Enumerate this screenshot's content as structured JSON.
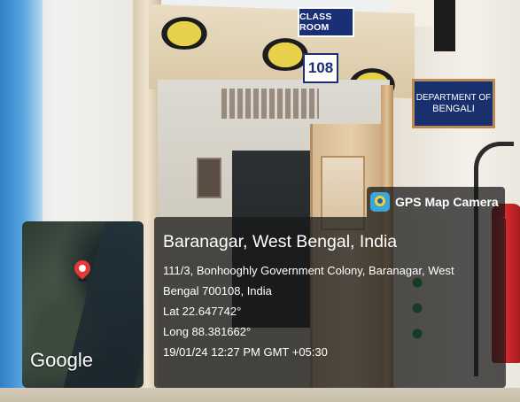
{
  "photo": {
    "signs": {
      "class_room": "CLASS ROOM",
      "room_number": "108",
      "department_line1": "DEPARTMENT OF",
      "department_line2": "BENGALI"
    }
  },
  "gps_overlay": {
    "app_name": "GPS Map Camera",
    "app_icon": "gps-camera-icon",
    "map_logo": "Google",
    "pin_icon": "map-pin-icon",
    "pin_color": "#e53935",
    "place_title": "Baranagar, West Bengal, India",
    "address_line1": "111/3, Bonhooghly Government Colony, Baranagar, West",
    "address_line2": "Bengal 700108, India",
    "latitude": "Lat 22.647742°",
    "longitude": "Long 88.381662°",
    "timestamp": "19/01/24 12:27 PM GMT +05:30",
    "panel_color": "#181818"
  }
}
